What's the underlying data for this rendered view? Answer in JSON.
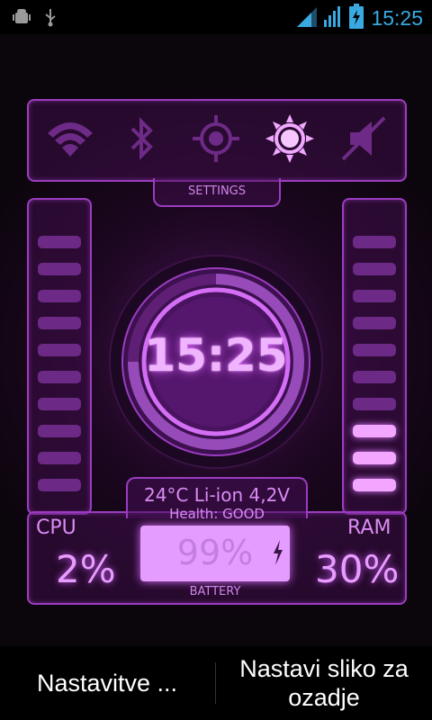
{
  "status_bar": {
    "time": "15:25",
    "icons": [
      "android-debug-icon",
      "usb-icon",
      "wifi-signal-icon",
      "cell-signal-icon",
      "battery-charging-icon"
    ]
  },
  "toggles": [
    {
      "name": "wifi",
      "icon": "wifi-icon",
      "active": false
    },
    {
      "name": "bluetooth",
      "icon": "bluetooth-icon",
      "active": false
    },
    {
      "name": "gps",
      "icon": "gps-icon",
      "active": false
    },
    {
      "name": "brightness",
      "icon": "sun-icon",
      "active": true
    },
    {
      "name": "sound",
      "icon": "mute-icon",
      "active": false
    }
  ],
  "settings_label": "SETTINGS",
  "clock": {
    "time": "15:25"
  },
  "battery_info": {
    "line": "24°C Li-ion  4,2V",
    "health": "Health: GOOD"
  },
  "cpu": {
    "label": "CPU",
    "value": "2%",
    "level": 0.0
  },
  "ram": {
    "label": "RAM",
    "value": "30%",
    "level": 0.3
  },
  "battery": {
    "percent": "99%",
    "label": "BATTERY",
    "level": 0.99
  },
  "buttons": {
    "settings": "Nastavitve ...",
    "wallpaper_line1": "Nastavi sliko za",
    "wallpaper_line2": "ozadje"
  },
  "colors": {
    "accent": "#d77df0",
    "bar_off": "#6c2a86",
    "bar_on": "#f2a6ff",
    "status_time": "#3aa9e0"
  }
}
